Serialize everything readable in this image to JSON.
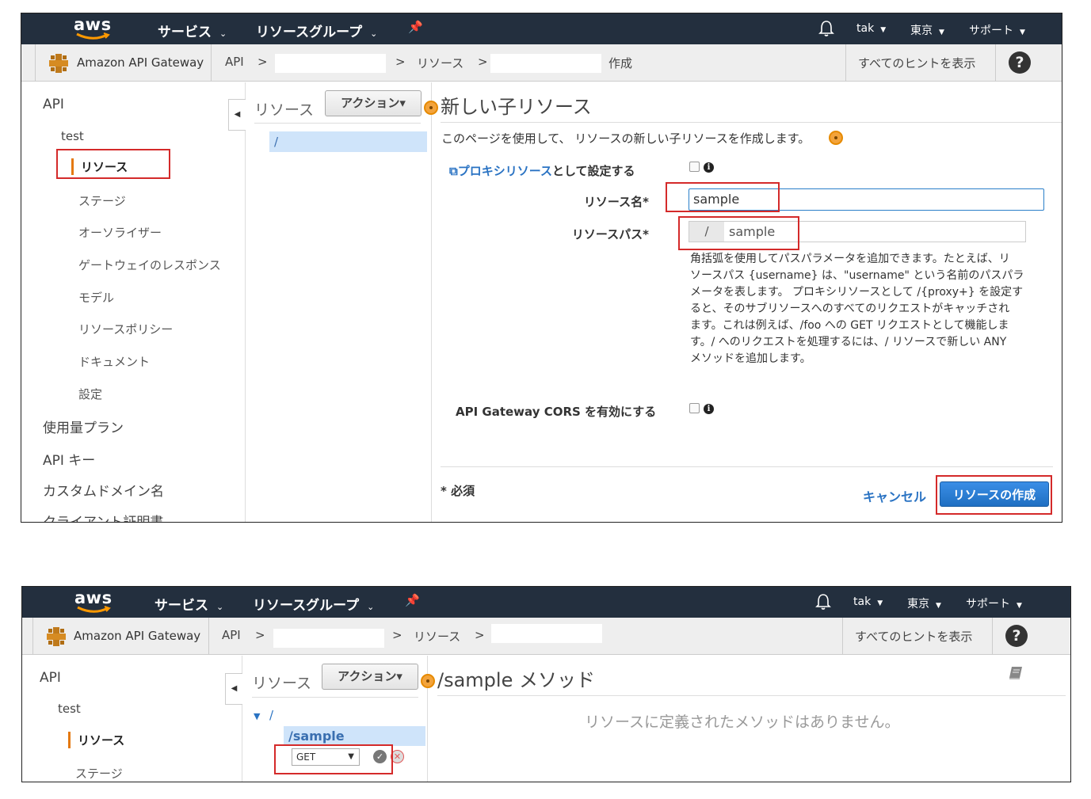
{
  "common": {
    "aws_logo": "aws",
    "nav_services": "サービス",
    "nav_resource_groups": "リソースグループ",
    "nav_user": "tak",
    "nav_region": "東京",
    "nav_support": "サポート",
    "service_name": "Amazon API Gateway",
    "crumb_api": "API",
    "crumb_sep": ">",
    "crumb_resources": "リソース",
    "show_hints": "すべてのヒントを表示",
    "help_icon": "?",
    "icons": [
      "bell-icon",
      "pin-icon",
      "help-icon",
      "api-gateway-logo-icon",
      "collapse-icon",
      "info-icon",
      "book-icon",
      "check-icon",
      "cancel-icon"
    ]
  },
  "screen1": {
    "crumb_create": "作成",
    "sidebar": {
      "api": "API",
      "test": "test",
      "resources": "リソース",
      "stages": "ステージ",
      "authorizers": "オーソライザー",
      "gateway_responses": "ゲートウェイのレスポンス",
      "models": "モデル",
      "resource_policy": "リソースポリシー",
      "documentation": "ドキュメント",
      "settings": "設定",
      "usage_plans": "使用量プラン",
      "api_keys": "API キー",
      "custom_domains": "カスタムドメイン名",
      "client_certs": "クライアント証明書"
    },
    "resources_panel": {
      "title": "リソース",
      "actions": "アクション",
      "root": "/"
    },
    "form": {
      "title": "新しい子リソース",
      "description": "このページを使用して、 リソースの新しい子リソースを作成します。",
      "proxy_link": "プロキシリソース",
      "proxy_suffix": "として設定する",
      "name_label": "リソース名*",
      "name_value": "sample",
      "path_label": "リソースパス*",
      "path_prefix": "/",
      "path_value": "sample",
      "help_lines": [
        "角括弧を使用してパスパラメータを追加できます。たとえば、リ",
        "ソースパス {username} は、\"username\" という名前のパスパラ",
        "メータを表します。 プロキシリソースとして /{proxy+} を設定す",
        "ると、そのサブリソースへのすべてのリクエストがキャッチされ",
        "ます。これは例えば、/foo への GET リクエストとして機能しま",
        "す。/ へのリクエストを処理するには、/ リソースで新しい ANY",
        "メソッドを追加します。"
      ],
      "cors_label": "API Gateway CORS を有効にする",
      "required": "* 必須",
      "cancel": "キャンセル",
      "create": "リソースの作成"
    }
  },
  "screen2": {
    "sidebar": {
      "api": "API",
      "test": "test",
      "resources": "リソース",
      "stages": "ステージ"
    },
    "resources_panel": {
      "title": "リソース",
      "actions": "アクション",
      "root": "/",
      "child": "/sample",
      "method_select": "GET"
    },
    "main": {
      "title": "/sample メソッド",
      "empty": "リソースに定義されたメソッドはありません。"
    }
  }
}
